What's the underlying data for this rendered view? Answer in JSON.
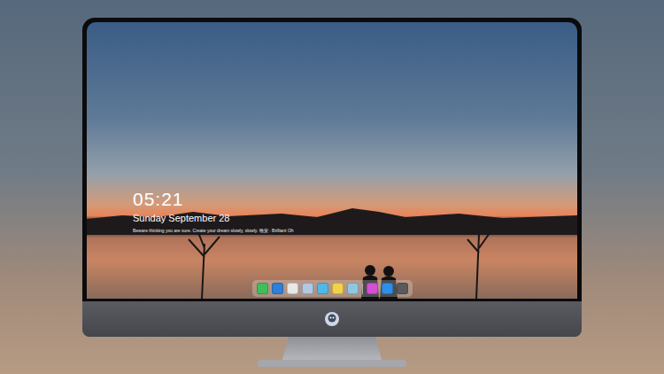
{
  "lock_screen": {
    "time": "05:21",
    "date": "Sunday September 28",
    "message": "Beware thinking you are sure. Create your dream slowly, slowly. 晚安 · Brilliant Oh"
  },
  "dock": {
    "items": [
      {
        "color": "#3fbf5a"
      },
      {
        "color": "#2f7fd8"
      },
      {
        "color": "#e8e8e8"
      },
      {
        "color": "#b0c8e0"
      },
      {
        "color": "#4fb8e8"
      },
      {
        "color": "#f2d24a"
      },
      {
        "color": "#8fc7e0"
      },
      {
        "color": "#d34fd6"
      },
      {
        "color": "#2d8fe8"
      },
      {
        "color": "#5a5a5e"
      }
    ]
  }
}
